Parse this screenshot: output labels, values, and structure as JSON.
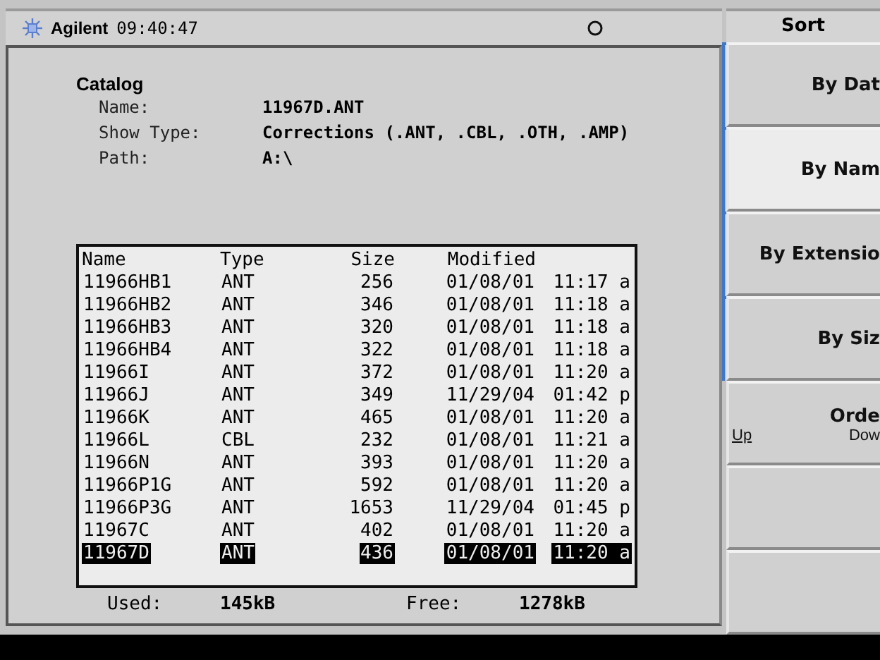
{
  "title_bar": {
    "brand": "Agilent",
    "time": "09:40:47"
  },
  "catalog": {
    "heading": "Catalog",
    "fields": [
      {
        "label": "Name:",
        "value": "11967D.ANT"
      },
      {
        "label": "Show Type:",
        "value": "Corrections (.ANT, .CBL, .OTH, .AMP)"
      },
      {
        "label": "Path:",
        "value": "A:\\"
      }
    ]
  },
  "table": {
    "columns": [
      "Name",
      "Type",
      "Size",
      "Modified"
    ],
    "rows": [
      {
        "cells": [
          "11966HB1",
          "ANT",
          "256",
          "01/08/01",
          "11:17 a"
        ],
        "selected": false
      },
      {
        "cells": [
          "11966HB2",
          "ANT",
          "346",
          "01/08/01",
          "11:18 a"
        ],
        "selected": false
      },
      {
        "cells": [
          "11966HB3",
          "ANT",
          "320",
          "01/08/01",
          "11:18 a"
        ],
        "selected": false
      },
      {
        "cells": [
          "11966HB4",
          "ANT",
          "322",
          "01/08/01",
          "11:18 a"
        ],
        "selected": false
      },
      {
        "cells": [
          "11966I",
          "ANT",
          "372",
          "01/08/01",
          "11:20 a"
        ],
        "selected": false
      },
      {
        "cells": [
          "11966J",
          "ANT",
          "349",
          "11/29/04",
          "01:42 p"
        ],
        "selected": false
      },
      {
        "cells": [
          "11966K",
          "ANT",
          "465",
          "01/08/01",
          "11:20 a"
        ],
        "selected": false
      },
      {
        "cells": [
          "11966L",
          "CBL",
          "232",
          "01/08/01",
          "11:21 a"
        ],
        "selected": false
      },
      {
        "cells": [
          "11966N",
          "ANT",
          "393",
          "01/08/01",
          "11:20 a"
        ],
        "selected": false
      },
      {
        "cells": [
          "11966P1G",
          "ANT",
          "592",
          "01/08/01",
          "11:20 a"
        ],
        "selected": false
      },
      {
        "cells": [
          "11966P3G",
          "ANT",
          "1653",
          "11/29/04",
          "01:45 p"
        ],
        "selected": false
      },
      {
        "cells": [
          "11967C",
          "ANT",
          "402",
          "01/08/01",
          "11:20 a"
        ],
        "selected": false
      },
      {
        "cells": [
          "11967D",
          "ANT",
          "436",
          "01/08/01",
          "11:20 a"
        ],
        "selected": true
      }
    ]
  },
  "usage": [
    {
      "label": "Used:",
      "value": "145kB"
    },
    {
      "label": "Free:",
      "value": "1278kB"
    }
  ],
  "softkeys": {
    "title": "Sort",
    "keys": [
      {
        "kind": "button",
        "label": "By Dat",
        "selected": false,
        "grouped": true
      },
      {
        "kind": "button",
        "label": "By Nam",
        "selected": true,
        "grouped": true
      },
      {
        "kind": "button",
        "label": "By Extensio",
        "selected": false,
        "grouped": true
      },
      {
        "kind": "button",
        "label": "By Siz",
        "selected": false,
        "grouped": true
      },
      {
        "kind": "toggle",
        "label": "Orde",
        "options": [
          {
            "label": "Up",
            "selected": true
          },
          {
            "label": "Dow",
            "selected": false
          }
        ]
      },
      {
        "kind": "blank"
      },
      {
        "kind": "blank"
      }
    ]
  }
}
